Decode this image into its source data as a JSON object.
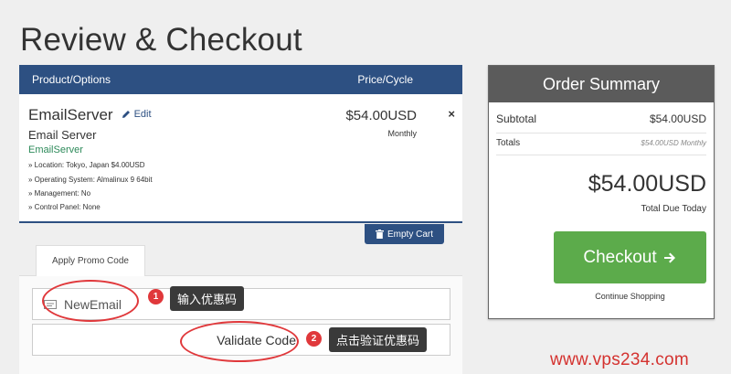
{
  "page": {
    "title": "Review & Checkout"
  },
  "cart": {
    "header": {
      "product": "Product/Options",
      "price": "Price/Cycle"
    },
    "item": {
      "name": "EmailServer",
      "edit_label": "Edit",
      "group": "Email Server",
      "sub": "EmailServer",
      "options": [
        "» Location: Tokyo, Japan $4.00USD",
        "» Operating System: Almalinux 9 64bit",
        "» Management: No",
        "» Control Panel: None"
      ],
      "price": "$54.00USD",
      "cycle": "Monthly",
      "remove_glyph": "×"
    },
    "empty_cart_label": "Empty Cart"
  },
  "promo": {
    "tab_label": "Apply Promo Code",
    "code_value": "NewEmail",
    "validate_label": "Validate Code"
  },
  "annotations": {
    "step1": {
      "number": "1",
      "text": "输入优惠码"
    },
    "step2": {
      "number": "2",
      "text": "点击验证优惠码"
    }
  },
  "summary": {
    "title": "Order Summary",
    "subtotal_label": "Subtotal",
    "subtotal_value": "$54.00USD",
    "totals_label": "Totals",
    "totals_value": "$54.00USD Monthly",
    "total_amount": "$54.00USD",
    "total_due_label": "Total Due Today",
    "checkout_label": "Checkout",
    "continue_label": "Continue Shopping"
  },
  "watermark": "www.vps234.com",
  "colors": {
    "header_blue": "#2d5082",
    "checkout_green": "#5cab4b",
    "annotation_red": "#e0383b",
    "summary_header_gray": "#5b5b5b"
  }
}
